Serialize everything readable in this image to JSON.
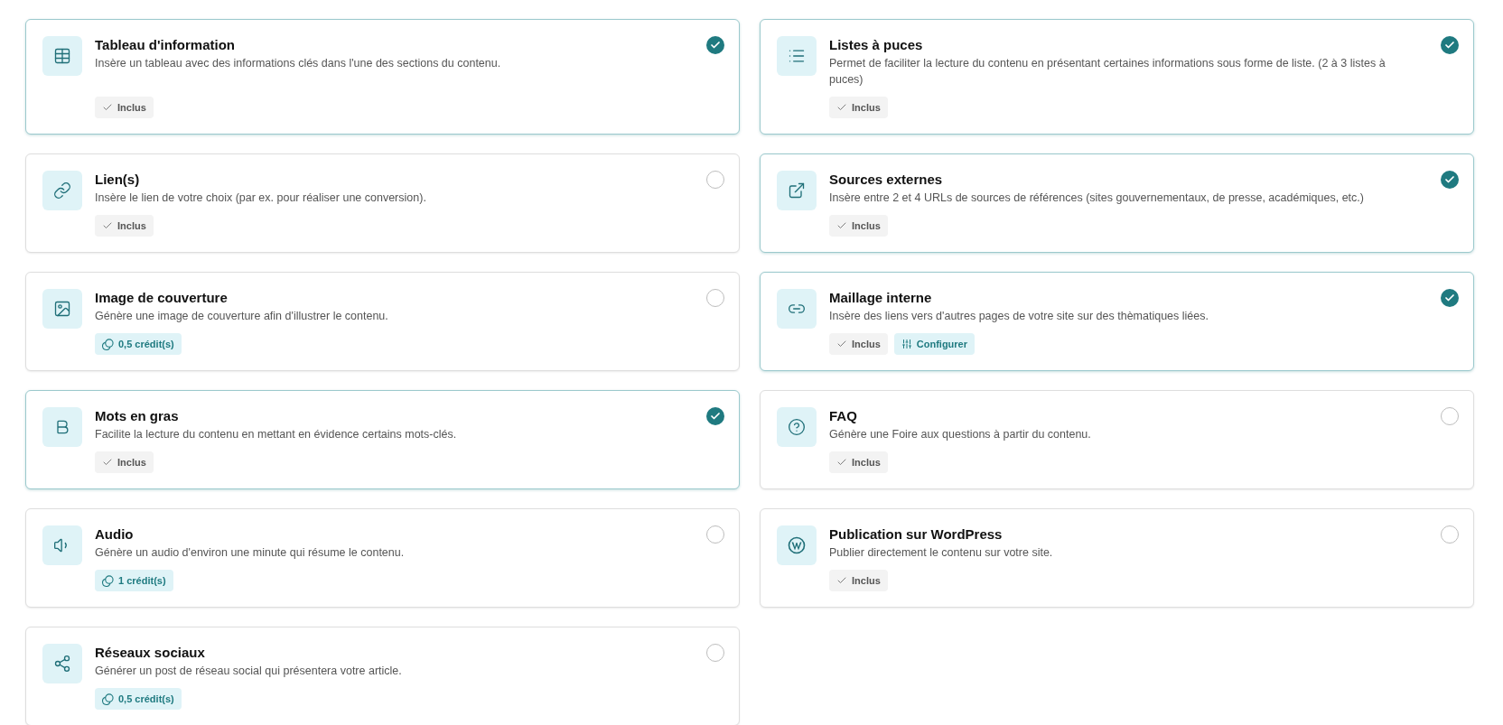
{
  "options": [
    {
      "title": "Tableau d'information",
      "description": "Insère un tableau avec des informations clés dans l'une des sections du contenu.",
      "selected": true,
      "tags": [
        {
          "kind": "included",
          "label": "Inclus"
        }
      ]
    },
    {
      "title": "Listes à puces",
      "description": "Permet de faciliter la lecture du contenu en présentant certaines informations sous forme de liste. (2 à 3 listes à puces)",
      "selected": true,
      "tags": [
        {
          "kind": "included",
          "label": "Inclus"
        }
      ]
    },
    {
      "title": "Lien(s)",
      "description": "Insère le lien de votre choix (par ex. pour réaliser une conversion).",
      "selected": false,
      "tags": [
        {
          "kind": "included",
          "label": "Inclus"
        }
      ]
    },
    {
      "title": "Sources externes",
      "description": "Insère entre 2 et 4 URLs de sources de références (sites gouvernementaux, de presse, académiques, etc.)",
      "selected": true,
      "tags": [
        {
          "kind": "included",
          "label": "Inclus"
        }
      ]
    },
    {
      "title": "Image de couverture",
      "description": "Génère une image de couverture afin d'illustrer le contenu.",
      "selected": false,
      "tags": [
        {
          "kind": "credits",
          "label": "0,5 crédit(s)"
        }
      ]
    },
    {
      "title": "Maillage interne",
      "description": "Insère des liens vers d'autres pages de votre site sur des thèmatiques liées.",
      "selected": true,
      "tags": [
        {
          "kind": "included",
          "label": "Inclus"
        },
        {
          "kind": "configure",
          "label": "Configurer"
        }
      ]
    },
    {
      "title": "Mots en gras",
      "description": "Facilite la lecture du contenu en mettant en évidence certains mots-clés.",
      "selected": true,
      "tags": [
        {
          "kind": "included",
          "label": "Inclus"
        }
      ]
    },
    {
      "title": "FAQ",
      "description": "Génère une Foire aux questions à partir du contenu.",
      "selected": false,
      "tags": [
        {
          "kind": "included",
          "label": "Inclus"
        }
      ]
    },
    {
      "title": "Audio",
      "description": "Génère un audio d'environ une minute qui résume le contenu.",
      "selected": false,
      "tags": [
        {
          "kind": "credits",
          "label": "1 crédit(s)"
        }
      ]
    },
    {
      "title": "Publication sur WordPress",
      "description": "Publier directement le contenu sur votre site.",
      "selected": false,
      "tags": [
        {
          "kind": "included",
          "label": "Inclus"
        }
      ]
    },
    {
      "title": "Réseaux sociaux",
      "description": "Générer un post de réseau social qui présentera votre article.",
      "selected": false,
      "tags": [
        {
          "kind": "credits",
          "label": "0,5 crédit(s)"
        }
      ]
    }
  ]
}
